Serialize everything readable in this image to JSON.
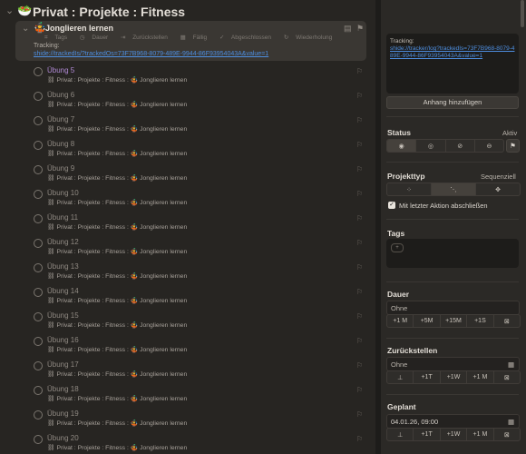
{
  "header": {
    "title": "Privat : Projekte : Fitness",
    "project_icon": "🥗"
  },
  "selected_task": {
    "icon": "🤹",
    "title": "Jonglieren lernen",
    "chips": [
      "Tags",
      "Dauer",
      "Zurückstellen",
      "Fällig",
      "Abgeschlossen",
      "Wiederholung"
    ],
    "note_label": "Tracking:",
    "note_link": "shide://trackedIs/?trackedOs=73F7B968-8079-489E-9944-86F93954043A&value=1"
  },
  "tasks": [
    {
      "name": "Übung 5",
      "accent": true
    },
    {
      "name": "Übung 6",
      "accent": false
    },
    {
      "name": "Übung 7",
      "accent": false
    },
    {
      "name": "Übung 8",
      "accent": false
    },
    {
      "name": "Übung 9",
      "accent": false
    },
    {
      "name": "Übung 10",
      "accent": false
    },
    {
      "name": "Übung 11",
      "accent": false
    },
    {
      "name": "Übung 12",
      "accent": false
    },
    {
      "name": "Übung 13",
      "accent": false
    },
    {
      "name": "Übung 14",
      "accent": false
    },
    {
      "name": "Übung 15",
      "accent": false
    },
    {
      "name": "Übung 16",
      "accent": false
    },
    {
      "name": "Übung 17",
      "accent": false
    },
    {
      "name": "Übung 18",
      "accent": false
    },
    {
      "name": "Übung 19",
      "accent": false
    },
    {
      "name": "Übung 20",
      "accent": false
    }
  ],
  "task_crumb": "Privat : Projekte : Fitness : 🤹 Jonglieren lernen",
  "inspector": {
    "note_label": "Tracking:",
    "note_link": "shide://tracker/log?trackedIs=73F7B968-8079-489E-9944-86F93954043A&value=1",
    "attach_label": "Anhang hinzufügen",
    "status": {
      "title": "Status",
      "value": "Aktiv"
    },
    "project_type": {
      "title": "Projekttyp",
      "value": "Sequenziell"
    },
    "complete_with_last_label": "Mit letzter Aktion abschließen",
    "tags": {
      "title": "Tags",
      "add_label": "+"
    },
    "duration": {
      "title": "Dauer",
      "value": "Ohne",
      "quick": [
        "+1 M",
        "+5M",
        "+15M",
        "+1S"
      ]
    },
    "defer": {
      "title": "Zurückstellen",
      "value": "Ohne",
      "quick": [
        "+1T",
        "+1W",
        "+1 M"
      ]
    },
    "planned": {
      "title": "Geplant",
      "value": "04.01.26, 09:00",
      "quick": [
        "+1T",
        "+1W",
        "+1 M"
      ]
    }
  }
}
